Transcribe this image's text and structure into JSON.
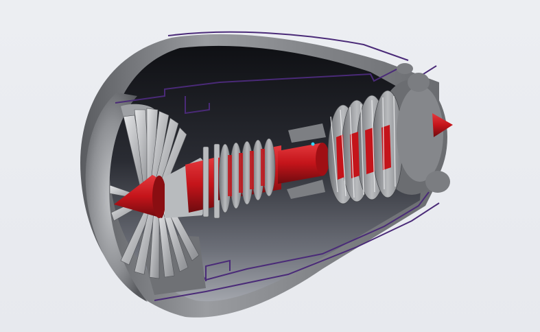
{
  "viewer": {
    "background_color": "#e9ebf0",
    "model": {
      "subject": "turbofan-engine-cutaway",
      "colors": {
        "nacelle": "#8d8f93",
        "nacelle_dark": "#4e5054",
        "section_edge": "#4a2a78",
        "rotor": "#c4141a",
        "rotor_dark": "#7a0c10",
        "blades": "#c9cbce",
        "interior": "#1a1c22",
        "highlight": "#36d6ff"
      }
    }
  }
}
